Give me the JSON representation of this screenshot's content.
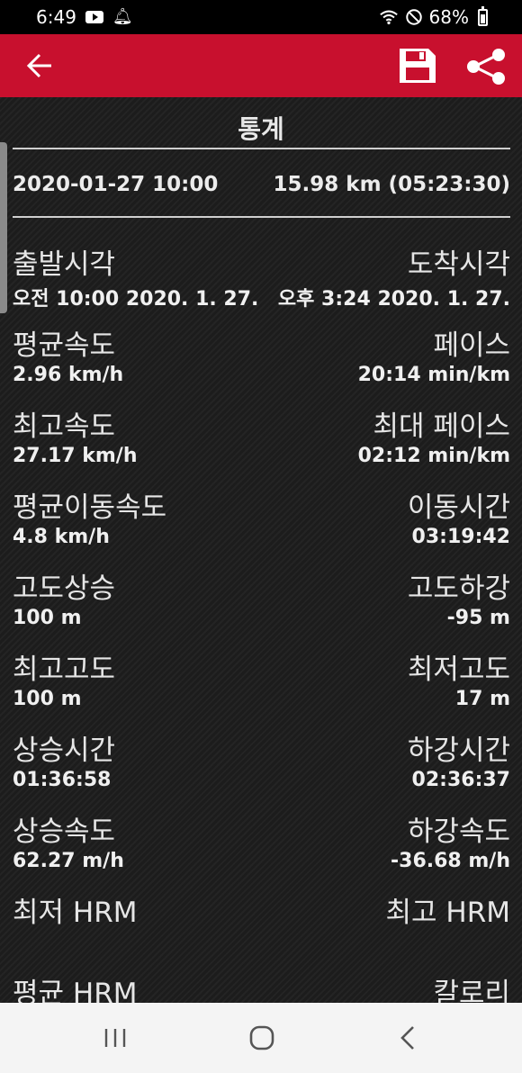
{
  "status_bar": {
    "time": "6:49",
    "battery": "68%"
  },
  "toolbar": {
    "back_icon": "arrow-back-icon",
    "save_icon": "floppy-disk-icon",
    "share_icon": "share-icon",
    "accent_color": "#c8102e"
  },
  "stats": {
    "title": "통계",
    "date": "2020-01-27 10:00",
    "distance_duration": "15.98 km (05:23:30)",
    "rows": [
      {
        "left_label": "출발시각",
        "left_value": "오전 10:00 2020. 1. 27.",
        "right_label": "도착시각",
        "right_value": "오후 3:24 2020. 1. 27."
      },
      {
        "left_label": "평균속도",
        "left_value": "2.96 km/h",
        "right_label": "페이스",
        "right_value": "20:14 min/km"
      },
      {
        "left_label": "최고속도",
        "left_value": "27.17 km/h",
        "right_label": "최대 페이스",
        "right_value": "02:12 min/km"
      },
      {
        "left_label": "평균이동속도",
        "left_value": "4.8 km/h",
        "right_label": "이동시간",
        "right_value": "03:19:42"
      },
      {
        "left_label": "고도상승",
        "left_value": "100 m",
        "right_label": "고도하강",
        "right_value": "-95 m"
      },
      {
        "left_label": "최고고도",
        "left_value": "100 m",
        "right_label": "최저고도",
        "right_value": "17 m"
      },
      {
        "left_label": "상승시간",
        "left_value": "01:36:58",
        "right_label": "하강시간",
        "right_value": "02:36:37"
      },
      {
        "left_label": "상승속도",
        "left_value": "62.27 m/h",
        "right_label": "하강속도",
        "right_value": "-36.68 m/h"
      },
      {
        "left_label": "최저 HRM",
        "left_value": "",
        "right_label": "최고 HRM",
        "right_value": ""
      },
      {
        "left_label": "평균 HRM",
        "left_value": "",
        "right_label": "칼로리",
        "right_value": ""
      }
    ]
  },
  "nav_bar": {
    "recent_icon": "recent-apps-icon",
    "home_icon": "home-icon",
    "back_icon": "nav-back-icon"
  }
}
